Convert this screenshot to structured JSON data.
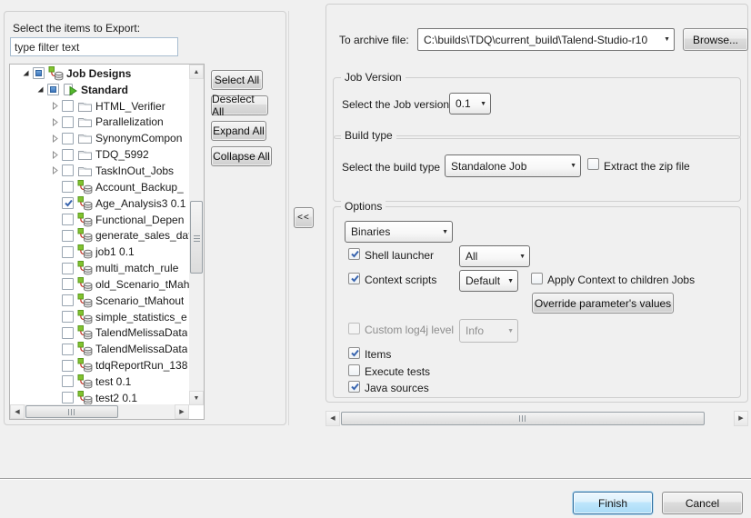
{
  "left_panel": {
    "label": "Select the items to Export:",
    "filter_value": "type filter text",
    "tree": {
      "items": [
        {
          "label": "Job Designs",
          "level": 0,
          "arrow": "expanded",
          "checkbox": "partial",
          "icon": "job-designs-icon",
          "bold": true
        },
        {
          "label": "Standard",
          "level": 1,
          "arrow": "expanded",
          "checkbox": "partial",
          "icon": "standard-job-icon",
          "bold": true
        },
        {
          "label": "HTML_Verifier",
          "level": 2,
          "arrow": "collapsed",
          "checkbox": "unchecked",
          "icon": "folder-icon",
          "bold": false
        },
        {
          "label": "Parallelization",
          "level": 2,
          "arrow": "collapsed",
          "checkbox": "unchecked",
          "icon": "folder-icon",
          "bold": false
        },
        {
          "label": "SynonymCompon",
          "level": 2,
          "arrow": "collapsed",
          "checkbox": "unchecked",
          "icon": "folder-icon",
          "bold": false
        },
        {
          "label": "TDQ_5992",
          "level": 2,
          "arrow": "collapsed",
          "checkbox": "unchecked",
          "icon": "folder-icon",
          "bold": false
        },
        {
          "label": "TaskInOut_Jobs",
          "level": 2,
          "arrow": "collapsed",
          "checkbox": "unchecked",
          "icon": "folder-icon",
          "bold": false
        },
        {
          "label": "Account_Backup_",
          "level": 2,
          "arrow": "none",
          "checkbox": "unchecked",
          "icon": "job-icon",
          "bold": false
        },
        {
          "label": "Age_Analysis3 0.1",
          "level": 2,
          "arrow": "none",
          "checkbox": "checked",
          "icon": "job-icon",
          "bold": false
        },
        {
          "label": "Functional_Depen",
          "level": 2,
          "arrow": "none",
          "checkbox": "unchecked",
          "icon": "job-icon",
          "bold": false
        },
        {
          "label": "generate_sales_dat",
          "level": 2,
          "arrow": "none",
          "checkbox": "unchecked",
          "icon": "job-icon",
          "bold": false
        },
        {
          "label": "job1 0.1",
          "level": 2,
          "arrow": "none",
          "checkbox": "unchecked",
          "icon": "job-icon",
          "bold": false
        },
        {
          "label": "multi_match_rule",
          "level": 2,
          "arrow": "none",
          "checkbox": "unchecked",
          "icon": "job-icon",
          "bold": false
        },
        {
          "label": "old_Scenario_tMah",
          "level": 2,
          "arrow": "none",
          "checkbox": "unchecked",
          "icon": "job-icon",
          "bold": false
        },
        {
          "label": "Scenario_tMahout",
          "level": 2,
          "arrow": "none",
          "checkbox": "unchecked",
          "icon": "job-icon",
          "bold": false
        },
        {
          "label": "simple_statistics_e",
          "level": 2,
          "arrow": "none",
          "checkbox": "unchecked",
          "icon": "job-icon",
          "bold": false
        },
        {
          "label": "TalendMelissaData",
          "level": 2,
          "arrow": "none",
          "checkbox": "unchecked",
          "icon": "job-icon",
          "bold": false
        },
        {
          "label": "TalendMelissaData",
          "level": 2,
          "arrow": "none",
          "checkbox": "unchecked",
          "icon": "job-icon",
          "bold": false
        },
        {
          "label": "tdqReportRun_138",
          "level": 2,
          "arrow": "none",
          "checkbox": "unchecked",
          "icon": "job-icon",
          "bold": false
        },
        {
          "label": "test 0.1",
          "level": 2,
          "arrow": "none",
          "checkbox": "unchecked",
          "icon": "job-icon",
          "bold": false
        },
        {
          "label": "test2 0.1",
          "level": 2,
          "arrow": "none",
          "checkbox": "unchecked",
          "icon": "job-icon",
          "bold": false
        }
      ]
    },
    "buttons": [
      "Select All",
      "Deselect All",
      "Expand All",
      "Collapse All"
    ]
  },
  "collapse_button": "<<",
  "right_panel": {
    "archive": {
      "label": "To archive file:",
      "value": "C:\\builds\\TDQ\\current_build\\Talend-Studio-r10",
      "browse": "Browse..."
    },
    "job_version": {
      "title": "Job Version",
      "label": "Select the Job version",
      "value": "0.1"
    },
    "build_type": {
      "title": "Build type",
      "label": "Select the build type",
      "value": "Standalone Job",
      "extract": {
        "label": "Extract the zip file",
        "checked": false
      }
    },
    "options": {
      "title": "Options",
      "binaries_value": "Binaries",
      "shell_launcher": {
        "label": "Shell launcher",
        "checked": true,
        "value": "All"
      },
      "context_scripts": {
        "label": "Context scripts",
        "checked": true,
        "value": "Default"
      },
      "apply_context": {
        "label": "Apply Context to children Jobs",
        "checked": false
      },
      "override_button": "Override parameter's values",
      "log4j": {
        "label": "Custom log4j level",
        "checked": false,
        "disabled": true,
        "value": "Info"
      },
      "items": {
        "label": "Items",
        "checked": true
      },
      "execute_tests": {
        "label": "Execute tests",
        "checked": false
      },
      "java_sources": {
        "label": "Java sources",
        "checked": true
      }
    }
  },
  "footer": {
    "finish": "Finish",
    "cancel": "Cancel"
  },
  "colors": {
    "accent_check": "#3a66b0",
    "partial_fill": "#3a72ba",
    "default_button_border": "#2f6d9e",
    "background": "#f0f0f0"
  }
}
